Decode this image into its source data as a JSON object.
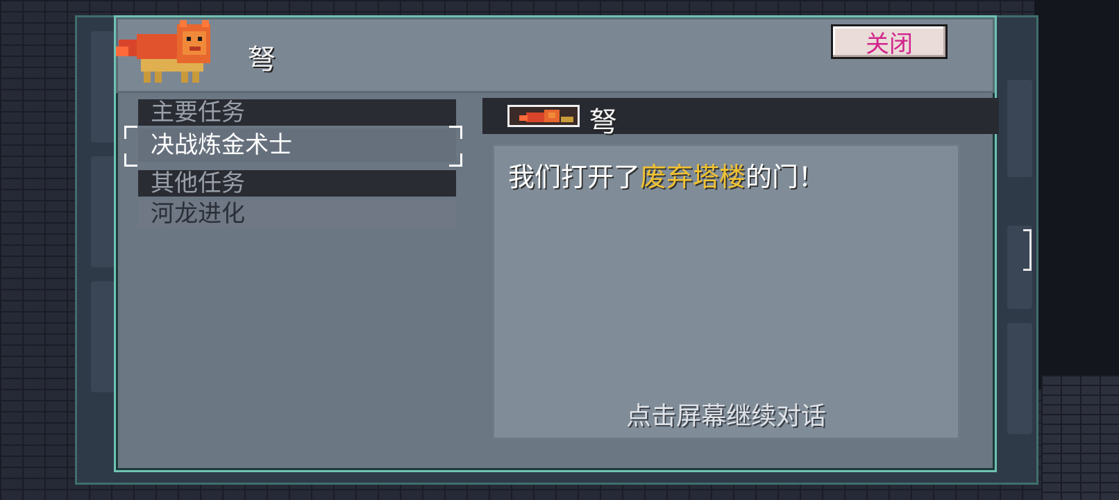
{
  "header": {
    "speaker_name": "弩",
    "close_label": "关闭"
  },
  "quest_list": {
    "main_category": "主要任务",
    "main_quest": "决战炼金术士",
    "other_category": "其他任务",
    "other_quest": "河龙进化"
  },
  "dialogue": {
    "speaker_name": "弩",
    "text_before": "我们打开了",
    "text_highlight": "废弃塔楼",
    "text_after": "的门！",
    "continue_hint": "点击屏幕继续对话"
  },
  "colors": {
    "highlight": "#f1c232",
    "close_text": "#d2258c",
    "frame": "#6fc2b4"
  },
  "icons": {
    "portrait": "red-lion-beast-portrait",
    "speaker_icon": "red-lion-beast-mini-icon"
  }
}
